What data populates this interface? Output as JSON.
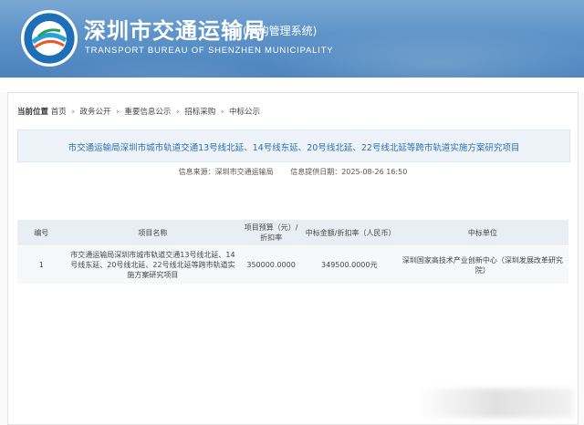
{
  "header": {
    "title_cn": "深圳市交通运输局",
    "subtitle": "(采购管理系统)",
    "title_en": "TRANSPORT BUREAU OF SHENZHEN MUNICIPALITY",
    "logo_text": "深圳市交通运输局"
  },
  "breadcrumb": {
    "label": "当前位置",
    "items": [
      "首页",
      "政务公开",
      "重要信息公示",
      "招标采购",
      "中标公示"
    ],
    "separator": "›"
  },
  "notice": {
    "title": "市交通运输局深圳市城市轨道交通13号线北延、14号线东延、20号线北延、22号线北延等跨市轨道实施方案研究项目",
    "source_label": "信息来源：深圳市交通运输局",
    "date_label": "信息提供日期：2025-08-26 16:50"
  },
  "table": {
    "headers": [
      "编号",
      "项目名称",
      "项目预算（元）/折扣率",
      "中标金额/折扣率（人民币）",
      "中标单位"
    ],
    "rows": [
      {
        "no": "1",
        "name": "市交通运输局深圳市城市轨道交通13号线北延、14号线东延、20号线北延、22号线北延等跨市轨道实施方案研究项目",
        "budget": "350000.0000",
        "amount": "349500.0000元",
        "unit": "深圳国家高技术产业创新中心（深圳发展改革研究院）"
      }
    ]
  },
  "colors": {
    "header_blue": "#5d93c8",
    "title_blue": "#2d6fb4",
    "table_header_bg": "#e9eef4"
  }
}
